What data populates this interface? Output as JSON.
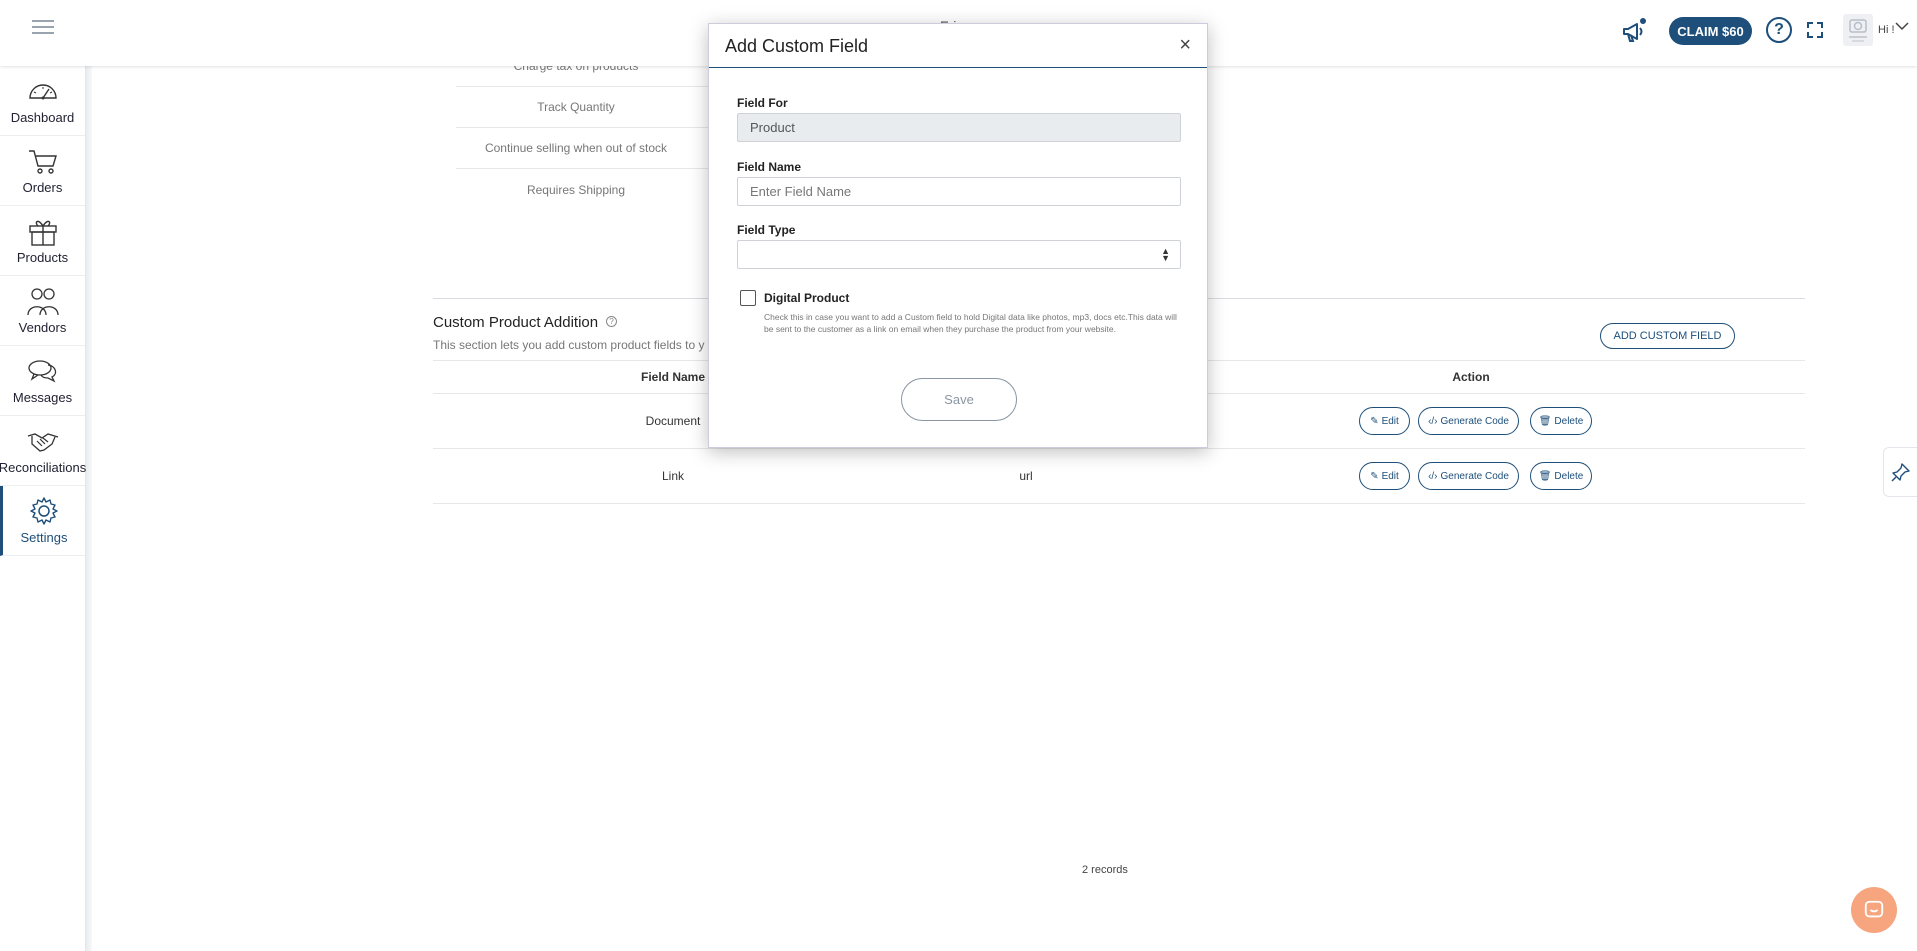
{
  "topbar": {
    "brand": "Fri",
    "claim_label": "CLAIM $60",
    "help_symbol": "?",
    "greeting": "Hi !",
    "icons": [
      "hamburger-icon",
      "megaphone-icon",
      "help-icon",
      "expand-icon",
      "avatar-photo",
      "chevron-down-icon"
    ],
    "accent_color": "#1d4f7a"
  },
  "sidebar": {
    "items": [
      {
        "label": "Dashboard",
        "icon": "speedometer-icon"
      },
      {
        "label": "Orders",
        "icon": "cart-icon"
      },
      {
        "label": "Products",
        "icon": "gift-icon"
      },
      {
        "label": "Vendors",
        "icon": "people-icon"
      },
      {
        "label": "Messages",
        "icon": "chat-icon"
      },
      {
        "label": "Reconciliations",
        "icon": "handshake-icon"
      },
      {
        "label": "Settings",
        "icon": "gear-icon",
        "active": true
      }
    ]
  },
  "main": {
    "toggles": [
      "Charge tax on products",
      "Track Quantity",
      "Continue selling when out of stock",
      "Requires Shipping"
    ],
    "section_title": "Custom Product Addition",
    "section_desc": "This section lets you add custom product fields to y",
    "add_button": "ADD CUSTOM FIELD",
    "table": {
      "headers": {
        "field_name": "Field Name",
        "field_type": "",
        "action": "Action"
      },
      "rows": [
        {
          "name": "Document",
          "type": ""
        },
        {
          "name": "Link",
          "type": "url"
        }
      ],
      "actions": {
        "edit": "Edit",
        "generate": "Generate Code",
        "delete": "Delete"
      }
    },
    "records": "2 records"
  },
  "modal": {
    "title": "Add Custom Field",
    "close_symbol": "×",
    "field_for_label": "Field For",
    "field_for_value": "Product",
    "field_name_label": "Field Name",
    "field_name_placeholder": "Enter Field Name",
    "field_type_label": "Field Type",
    "field_type_value": "",
    "digital_label": "Digital Product",
    "digital_help": "Check this in case you want to add a Custom field to hold Digital data like photos, mp3, docs etc.This data will be sent to the customer as a link on email when they purchase the product from your website.",
    "save_label": "Save"
  }
}
